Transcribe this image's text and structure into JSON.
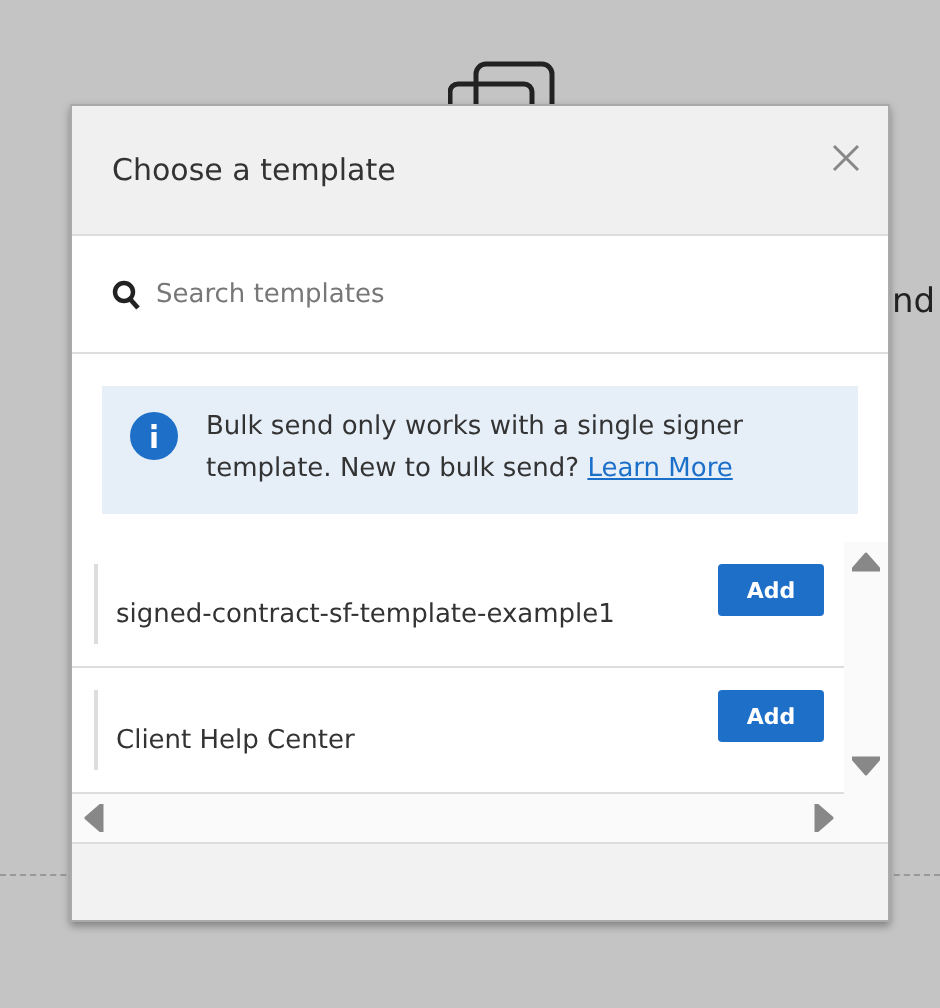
{
  "background": {
    "text": "nd"
  },
  "dialog": {
    "title": "Choose a template",
    "search": {
      "placeholder": "Search templates"
    },
    "info": {
      "text": "Bulk send only works with a single signer template. New to bulk send?",
      "link": "Learn More"
    },
    "templates": [
      {
        "name": "signed-contract-sf-template-example1",
        "action": "Add"
      },
      {
        "name": "Client Help Center",
        "action": "Add"
      }
    ]
  }
}
